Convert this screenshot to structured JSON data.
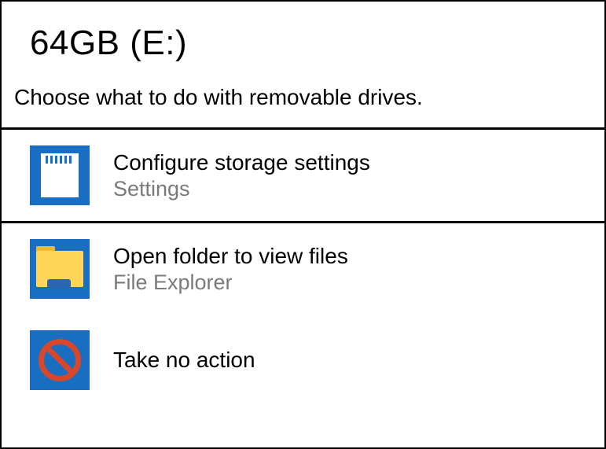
{
  "title": "64GB (E:)",
  "subtitle": "Choose what to do with removable drives.",
  "options": [
    {
      "label": "Configure storage settings",
      "sub": "Settings"
    },
    {
      "label": "Open folder to view files",
      "sub": "File Explorer"
    },
    {
      "label": "Take no action",
      "sub": ""
    }
  ]
}
